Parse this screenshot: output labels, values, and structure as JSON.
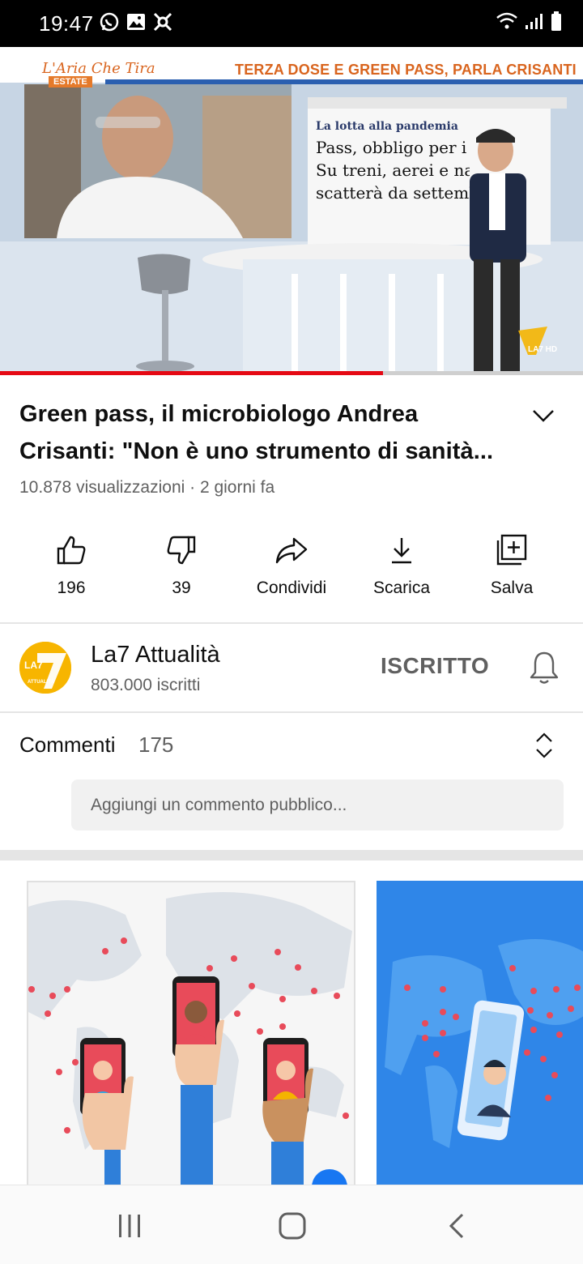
{
  "status_bar": {
    "time": "19:47",
    "left_icons": [
      "whatsapp-icon",
      "gallery-icon",
      "app-icon"
    ],
    "right_icons": [
      "wifi-icon",
      "signal-icon",
      "battery-icon"
    ]
  },
  "player": {
    "banner_logo": "L'Aria Che Tira",
    "banner_logo_badge": "ESTATE",
    "banner_headline": "TERZA DOSE E GREEN PASS, PARLA CRISANTI",
    "screen_paper_kicker": "La lotta alla pandemia",
    "screen_paper_headline_1": "Pass, obbligo per i prof",
    "screen_paper_headline_2": "Su treni, aerei e navi",
    "screen_paper_headline_3": "scatterà da settembre",
    "watermark": "LA7 HD",
    "progress_fraction": 0.657
  },
  "video": {
    "title": "Green pass, il microbiologo Andrea Crisanti: \"Non è uno strumento di sanità...",
    "meta": "10.878 visualizzazioni · 2 giorni fa"
  },
  "actions": {
    "like_label": "196",
    "dislike_label": "39",
    "share_label": "Condividi",
    "download_label": "Scarica",
    "save_label": "Salva"
  },
  "channel": {
    "name": "La7 Attualità",
    "subscribers": "803.000 iscritti",
    "subscribe_state": "ISCRITTO",
    "avatar_text": "LA7",
    "avatar_subtext": "ATTUALITÀ"
  },
  "comments": {
    "label": "Commenti",
    "count": "175",
    "placeholder": "Aggiungi un commento pubblico..."
  },
  "colors": {
    "progress": "#e50914",
    "avatar": "#f7b500",
    "ad_blue": "#2f86e8",
    "phone_red": "#e84b5a"
  }
}
